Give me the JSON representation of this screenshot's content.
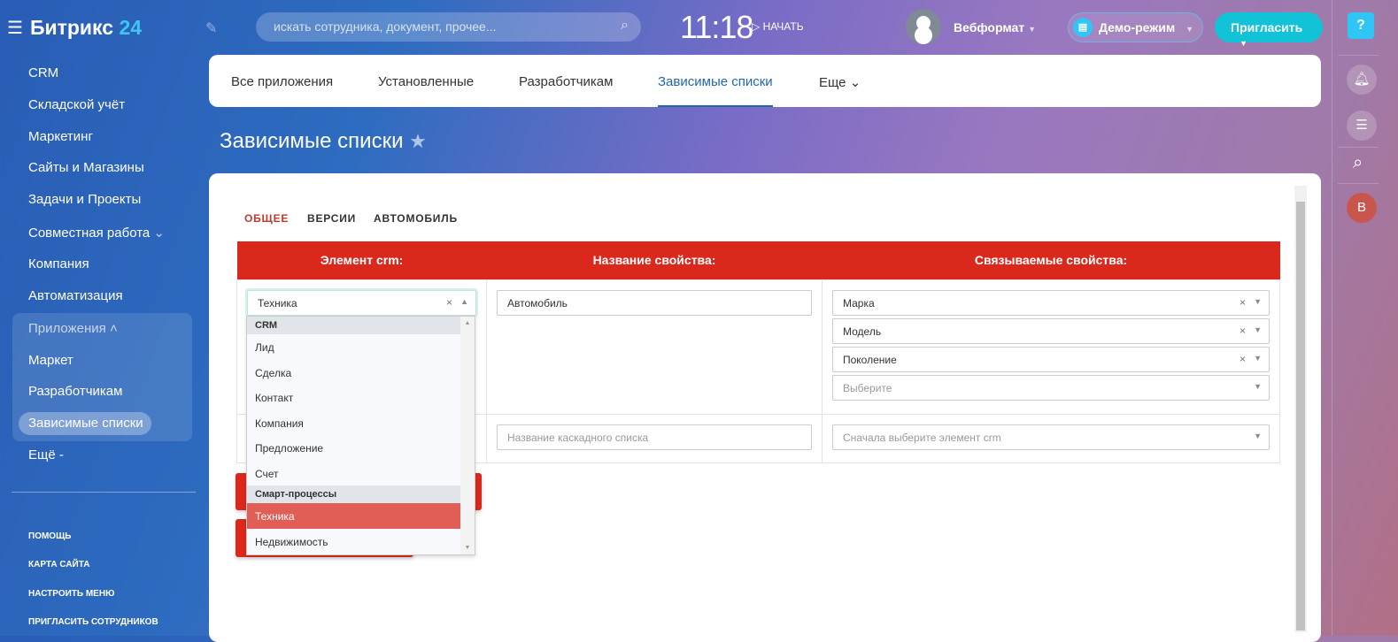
{
  "header": {
    "logo_text": "Битрикс",
    "logo_num": "24",
    "search_placeholder": "искать сотрудника, документ, прочее...",
    "time": "11:18",
    "start": "НАЧАТЬ",
    "user": "Вебформат",
    "demo": "Демо-режим",
    "invite": "Пригласить",
    "help": "?",
    "avatar_letter": "В"
  },
  "sidebar": {
    "items": [
      "CRM",
      "Складской учёт",
      "Маркетинг",
      "Сайты и Магазины",
      "Задачи и Проекты",
      "Совместная работа",
      "Компания",
      "Автоматизация",
      "Приложения",
      "Маркет",
      "Разработчикам",
      "Зависимые списки",
      "Ещё"
    ],
    "footer": [
      "ПОМОЩЬ",
      "КАРТА САЙТА",
      "НАСТРОИТЬ МЕНЮ",
      "ПРИГЛАСИТЬ СОТРУДНИКОВ"
    ]
  },
  "tabs": [
    "Все приложения",
    "Установленные",
    "Разработчикам",
    "Зависимые списки",
    "Еще"
  ],
  "page_title": "Зависимые списки",
  "subtabs": [
    "ОБЩЕЕ",
    "ВЕРСИИ",
    "АВТОМОБИЛЬ"
  ],
  "table": {
    "headers": [
      "Элемент crm:",
      "Название свойства:",
      "Связываемые свойства:"
    ],
    "row1": {
      "element": "Техника",
      "name": "Автомобиль",
      "props": [
        "Марка",
        "Модель",
        "Поколение"
      ],
      "props_placeholder": "Выберите"
    },
    "row2": {
      "name_placeholder": "Название каскадного списка",
      "props_placeholder": "Сначала выберите элемент crm"
    }
  },
  "dropdown": {
    "group1": "CRM",
    "items1": [
      "Лид",
      "Сделка",
      "Контакт",
      "Компания",
      "Предложение",
      "Счет"
    ],
    "group2": "Смарт-процессы",
    "items2": [
      "Техника",
      "Недвижимость"
    ]
  },
  "colors": {
    "accent": "#da291c",
    "selected": "#e05e56",
    "link": "#2067b0"
  }
}
